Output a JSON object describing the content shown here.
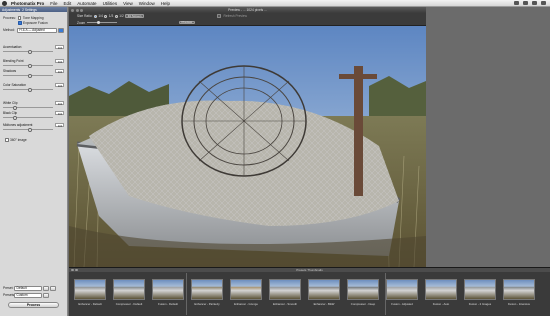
{
  "menubar": {
    "app_name": "Photomatix Pro",
    "items": [
      "File",
      "Edit",
      "Automate",
      "Utilities",
      "View",
      "Window",
      "Help"
    ]
  },
  "left_panel": {
    "tabs": [
      "Adjustments",
      "2 Settings"
    ],
    "process_label": "Process:",
    "tone_mapping_label": "Tone Mapping",
    "exposure_fusion_label": "Exposure Fusion",
    "method_label": "Method:",
    "method_value": "H & A — Adjusted",
    "sliders": [
      {
        "name": "Accentuation",
        "value": "0.0",
        "level": 0.5
      },
      {
        "name": "Blending Point",
        "value": "0.0",
        "level": 0.5
      },
      {
        "name": "Shadows",
        "value": "0.0",
        "level": 0.5
      },
      {
        "name": "Color Saturation",
        "value": "0.0",
        "level": 0.5
      },
      {
        "name": "White Clip",
        "value": "0.0",
        "level": 0.2
      },
      {
        "name": "Black Clip",
        "value": "0.0",
        "level": 0.2
      },
      {
        "name": "Midtones adjustment",
        "value": "0.0",
        "level": 0.5
      }
    ],
    "image360_label": "360° image",
    "preset_label": "Preset:",
    "preset_value": "Default",
    "presets_label": "Presets:",
    "presets_value": "Custom",
    "process_button": "Process"
  },
  "preview": {
    "title": "Preview - ... 1024 pixels ...",
    "size_radio_label": "Size Ratio:",
    "size_options": [
      "1/4",
      "1/3",
      "1/2"
    ],
    "fit_button": "Fit Screen",
    "zoom_label": "Zoom",
    "preview_button": "Preview",
    "refresh_label": "Refresh Preview"
  },
  "presets_strip": {
    "title": "Presets Thumbnails",
    "thumbnails": [
      "Enhancer - Default",
      "Compressor - Default",
      "Fusion - Default",
      "Enhancer - Painterly",
      "Enhancer - Grunge",
      "Enhancer - Smooth",
      "Enhancer - B&W",
      "Compressor - Deep",
      "Fusion - Adjusted",
      "Fusion - Auto",
      "Fusion - 2 Images",
      "Fusion - Intensive"
    ]
  }
}
